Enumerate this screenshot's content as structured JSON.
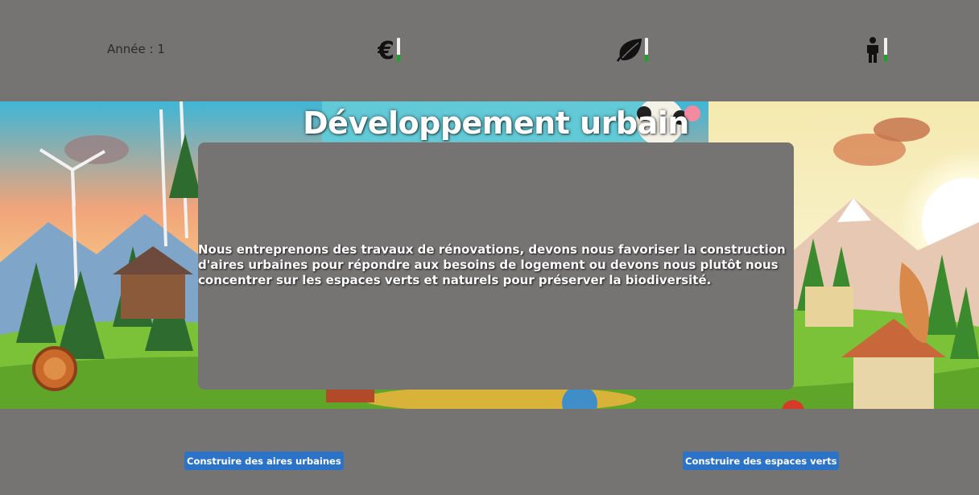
{
  "header": {
    "year_label": "Année : 1",
    "stats": [
      {
        "name": "money",
        "icon": "euro-icon",
        "level": 0.3
      },
      {
        "name": "ecology",
        "icon": "leaf-icon",
        "level": 0.3
      },
      {
        "name": "population",
        "icon": "person-icon",
        "level": 0.3
      }
    ],
    "gauge_color": "#1fa12c"
  },
  "event": {
    "title": "Développement urbain",
    "description": "Nous entreprenons des travaux de rénovations, devons nous favoriser la construction d'aires urbaines pour répondre aux besoins de logement ou devons nous plutôt nous concentrer sur les espaces verts et naturels pour préserver la biodiversité."
  },
  "choices": {
    "left_label": "Construire des aires urbaines",
    "right_label": "Construire des espaces verts"
  },
  "colors": {
    "background": "#767373",
    "button": "#2b72c9"
  }
}
